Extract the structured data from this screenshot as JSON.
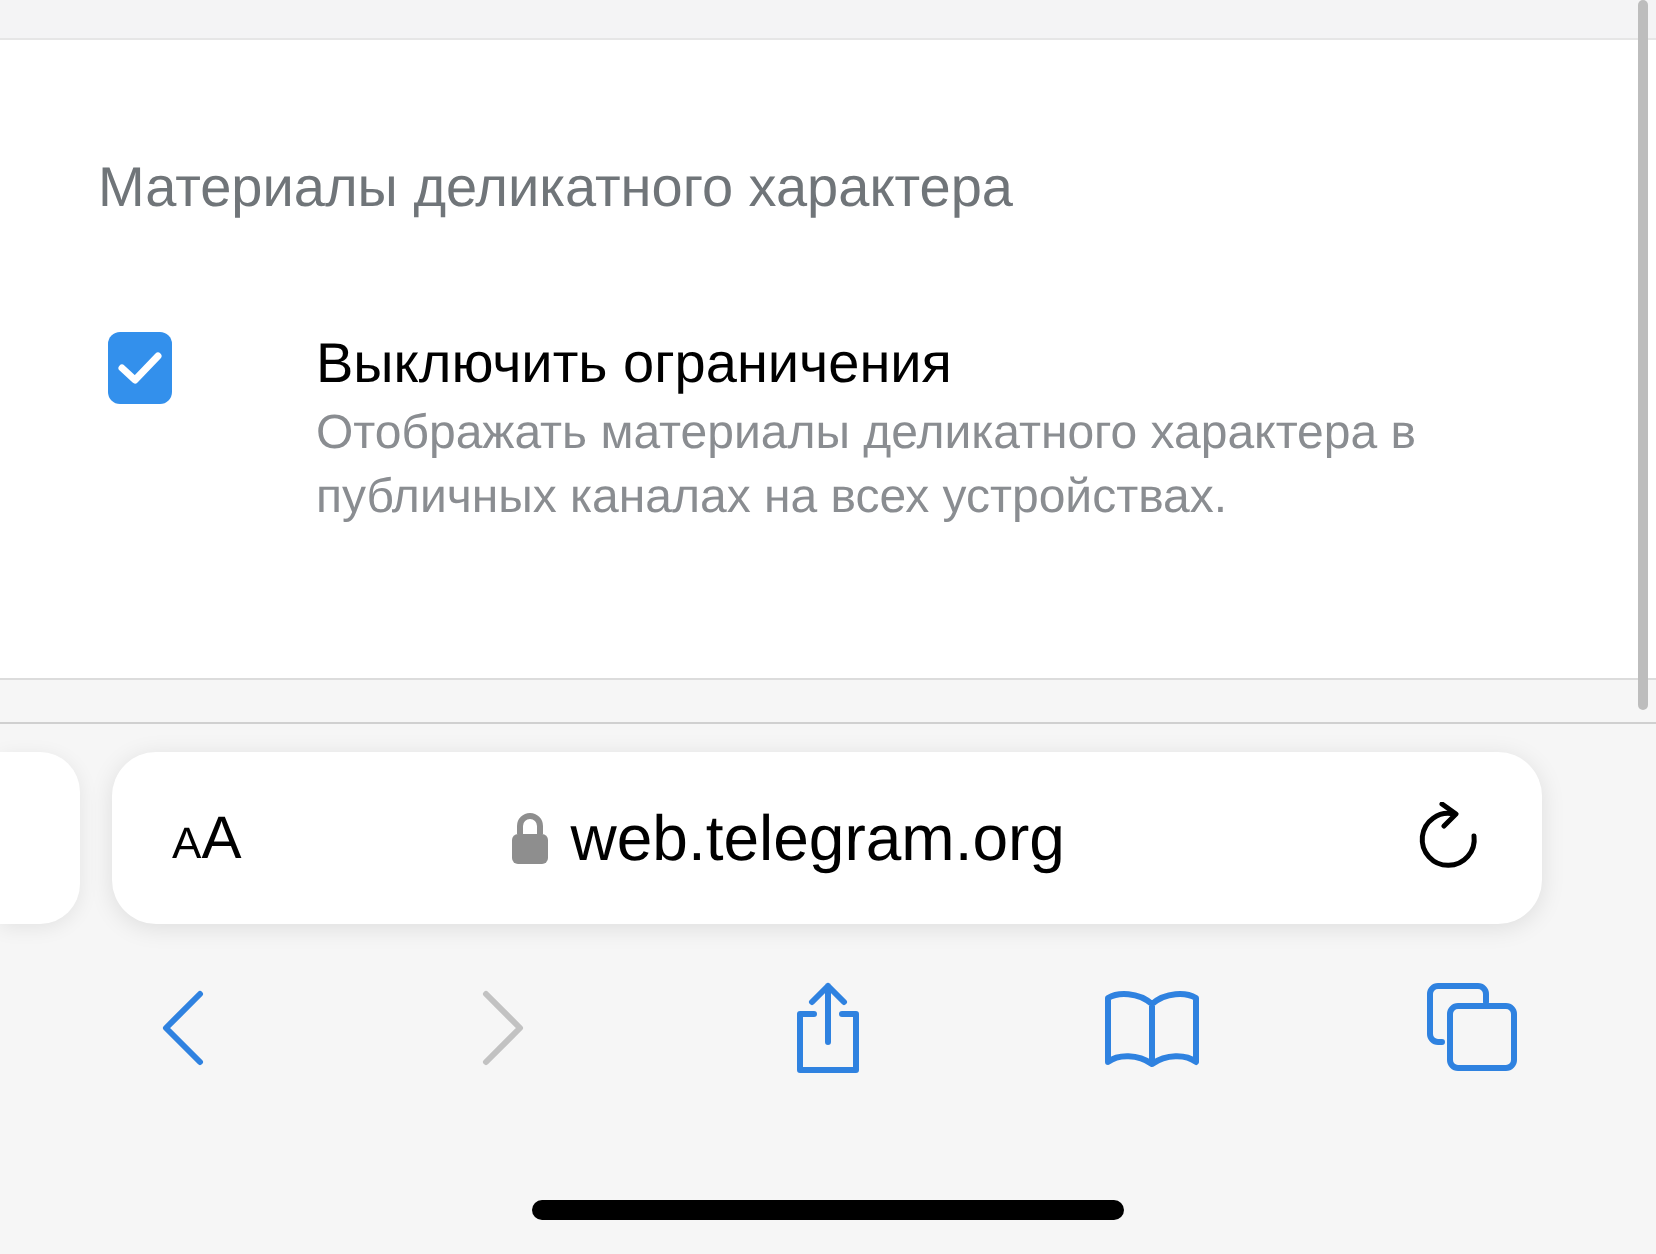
{
  "section": {
    "title": "Материалы деликатного характера"
  },
  "option": {
    "checked": true,
    "label": "Выключить ограничения",
    "description": "Отображать материалы деликатного характера в публичных каналах на всех устройствах."
  },
  "address_bar": {
    "format_label": "AA",
    "url": "web.telegram.org"
  },
  "toolbar": [
    {
      "kind": "back",
      "disabled": false
    },
    {
      "kind": "forward",
      "disabled": true
    },
    {
      "kind": "share",
      "disabled": false
    },
    {
      "kind": "bookmarks",
      "disabled": false
    },
    {
      "kind": "tabs",
      "disabled": false
    }
  ]
}
